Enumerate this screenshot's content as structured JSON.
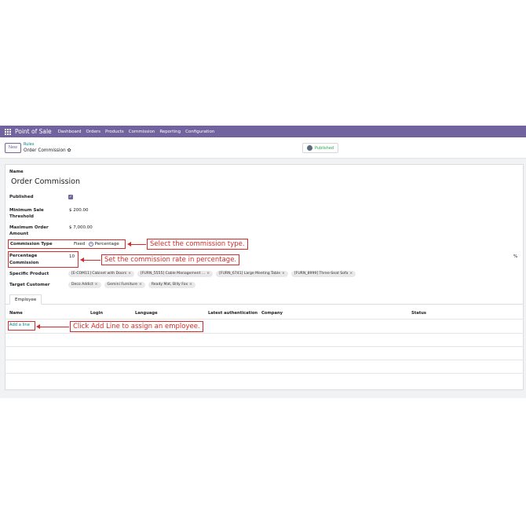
{
  "navbar": {
    "app_name": "Point of Sale",
    "items": [
      "Dashboard",
      "Orders",
      "Products",
      "Commission",
      "Reporting",
      "Configuration"
    ]
  },
  "control": {
    "new_label": "New",
    "breadcrumb_parent": "Rules",
    "breadcrumb_current": "Order Commission",
    "published_label": "Published"
  },
  "form": {
    "name_label": "Name",
    "name_value": "Order Commission",
    "published_label": "Published",
    "min_label_1": "Minimum Sale",
    "min_label_2": "Threshold",
    "min_value": "$ 200.00",
    "max_label_1": "Maximum Order",
    "max_label_2": "Amount",
    "max_value": "$ 7,000.00",
    "commission_type_label": "Commission Type",
    "fixed_label": "Fixed",
    "percentage_label": "Percentage",
    "pct_label_1": "Percentage",
    "pct_label_2": "Commission",
    "pct_value": "10",
    "pct_suffix": "%",
    "specific_product_label": "Specific Product",
    "specific_products": [
      "[E-COM11] Cabinet with Doors",
      "[FURN_5555] Cable Management ...",
      "[FURN_6741] Large Meeting Table",
      "[FURN_8999] Three-Seat Sofa"
    ],
    "target_customer_label": "Target Customer",
    "target_customers": [
      "Deco Addict",
      "Gemini Furniture",
      "Ready Mat, Billy Fox"
    ]
  },
  "tab": {
    "label": "Employee"
  },
  "table": {
    "columns": [
      "Name",
      "Login",
      "Language",
      "Latest authentication",
      "Company",
      "Status"
    ],
    "add_line": "Add a line"
  },
  "annotations": {
    "commission_type": "Select the commission type.",
    "percentage": "Set the commission rate in percentage.",
    "add_line": "Click Add Line to assign an employee."
  },
  "colors": {
    "brand": "#71639e",
    "link": "#017e84",
    "annotation": "#d62b2b"
  },
  "icons": [
    "apps-grid-icon",
    "gear-icon",
    "globe-icon",
    "tag-remove-icon",
    "checkbox-checked-icon"
  ]
}
